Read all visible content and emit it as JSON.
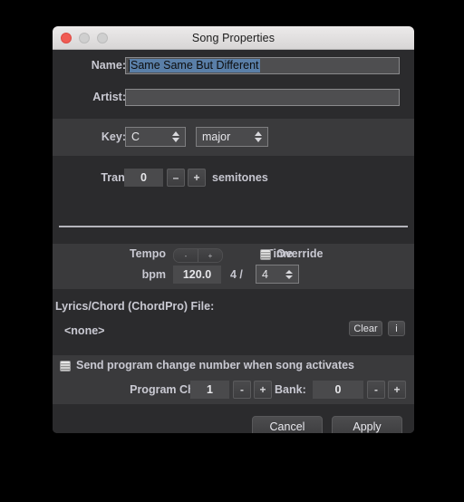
{
  "window": {
    "title": "Song Properties",
    "traffic_lights": [
      "close-button",
      "minimize-button",
      "maximize-button"
    ]
  },
  "form": {
    "name_label": "Name:",
    "name_value": "Same Same But Different",
    "name_placeholder": "",
    "artist_label": "Artist:",
    "artist_value": "",
    "artist_placeholder": "",
    "key_label": "Key:",
    "key_value": "C",
    "key_mode_value": "major",
    "transpose_label": "Transpose:",
    "transpose_value": "0",
    "transpose_minus": "–",
    "transpose_plus": "+",
    "transpose_units": "semitones"
  },
  "tempo": {
    "tempo_label": "Tempo",
    "bpm_label": "bpm",
    "bpm_value": "120.0",
    "nudge_minus": "-",
    "nudge_plus": "+",
    "time_label": "Time",
    "time_numerator": "4 /",
    "time_denominator": "4",
    "override_label": "Override"
  },
  "lyrics": {
    "section_label": "Lyrics/Chord (ChordPro) File:",
    "file_value": "<none>",
    "clear_label": "Clear",
    "info_label": "i"
  },
  "program": {
    "send_label": "Send program change number when song activates",
    "program_change_label": "Program Change:",
    "program_change_value": "1",
    "program_minus": "-",
    "program_plus": "+",
    "bank_label": "Bank:",
    "bank_value": "0",
    "bank_minus": "-",
    "bank_plus": "+"
  },
  "footer": {
    "cancel_label": "Cancel",
    "apply_label": "Apply"
  },
  "colors": {
    "window_bg": "#2b2b2d",
    "band_light": "#3a3a3c",
    "titlebar": "#eceaea",
    "selection": "#5a7fa8",
    "text": "#c9c9d2"
  }
}
